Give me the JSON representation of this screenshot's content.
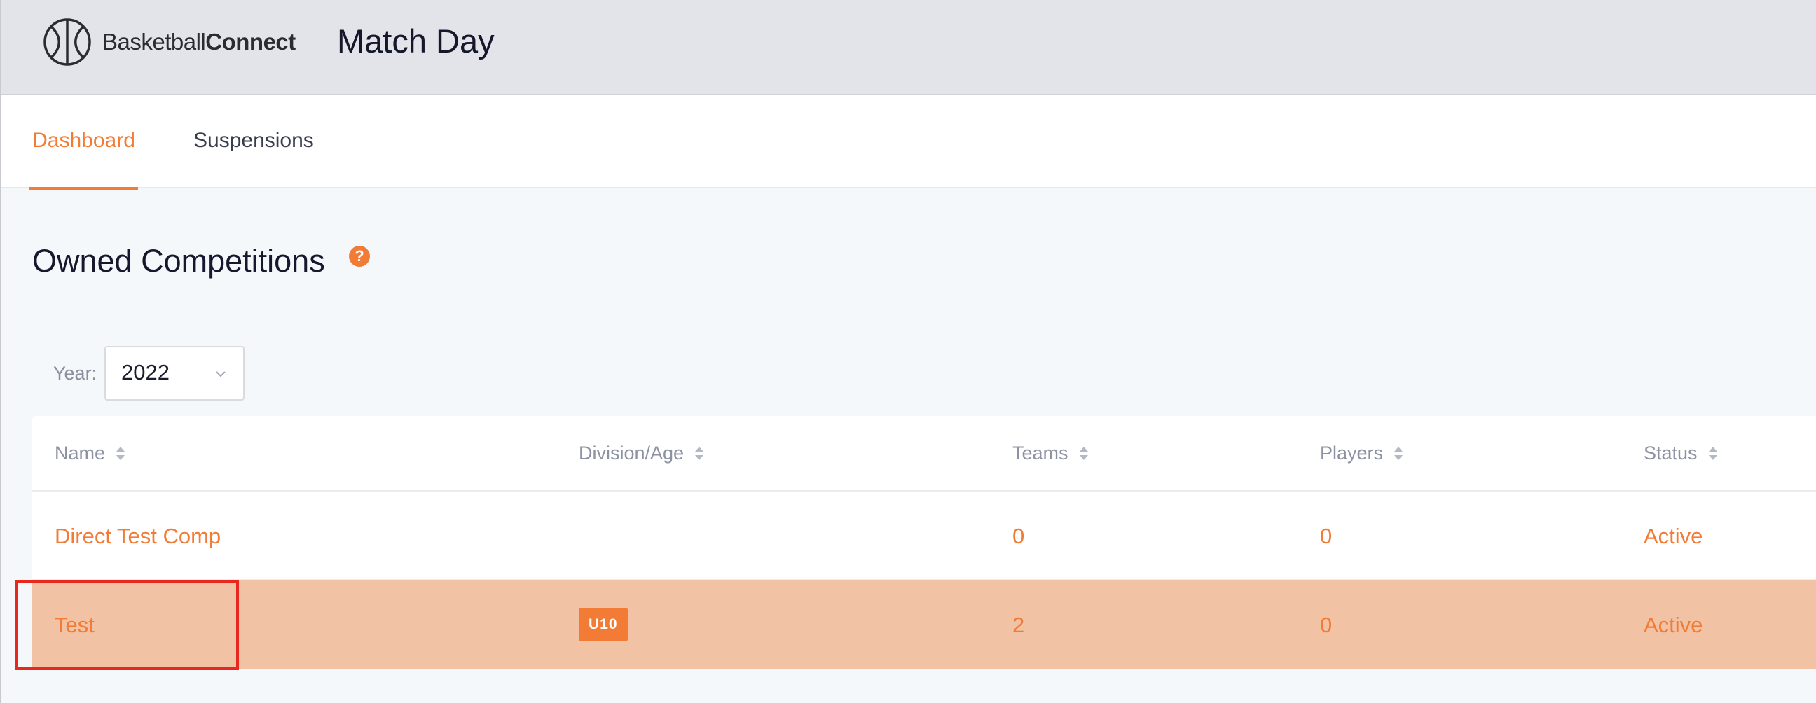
{
  "brand": {
    "logo_regular": "Basketball",
    "logo_bold": "Connect",
    "app_title": "Match Day"
  },
  "nav": {
    "tabs": [
      {
        "label": "Dashboard",
        "active": true
      },
      {
        "label": "Suspensions",
        "active": false
      }
    ]
  },
  "section": {
    "title": "Owned Competitions",
    "help_icon": "question-mark-icon",
    "help_glyph": "?"
  },
  "filters": {
    "year_label": "Year:",
    "year_value": "2022"
  },
  "table": {
    "columns": [
      "Name",
      "Division/Age",
      "Teams",
      "Players",
      "Status"
    ],
    "rows": [
      {
        "name": "Direct Test Comp",
        "division": "",
        "teams": "0",
        "players": "0",
        "status": "Active",
        "selected": false
      },
      {
        "name": "Test",
        "division": "U10",
        "teams": "2",
        "players": "0",
        "status": "Active",
        "selected": true
      }
    ]
  },
  "colors": {
    "accent": "#f27b35",
    "header_bg": "#e3e4e9",
    "selected_row": "#f1c2a3",
    "highlight_border": "#e8271f"
  }
}
